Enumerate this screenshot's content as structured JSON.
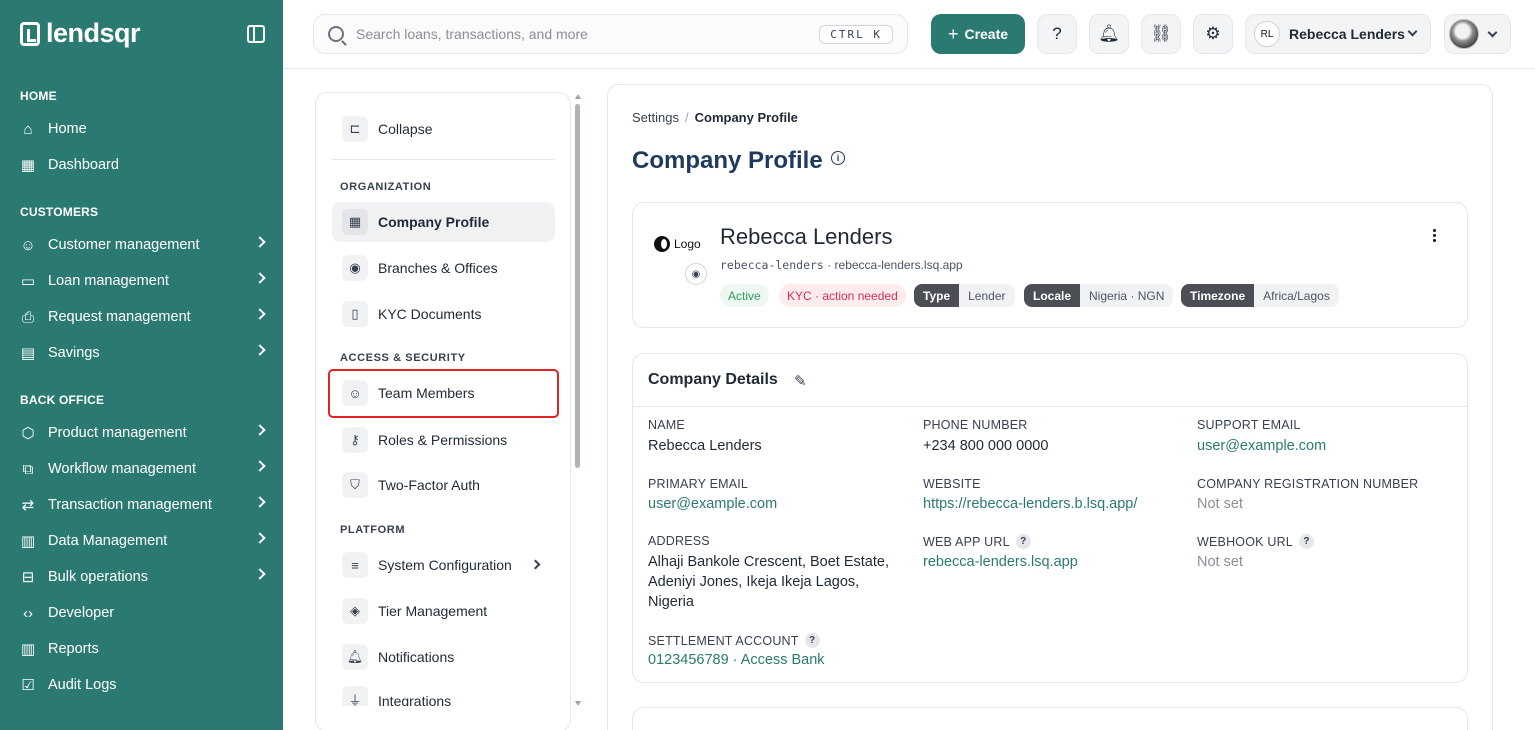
{
  "brand": {
    "name": "lendsqr"
  },
  "sidebar": {
    "sections": [
      {
        "label": "HOME"
      },
      {
        "label": "CUSTOMERS"
      },
      {
        "label": "BACK OFFICE"
      }
    ],
    "items": [
      {
        "label": "Home",
        "icon": "home-icon"
      },
      {
        "label": "Dashboard",
        "icon": "dashboard-icon"
      },
      {
        "label": "Customer management",
        "icon": "users-icon"
      },
      {
        "label": "Loan management",
        "icon": "loan-icon"
      },
      {
        "label": "Request management",
        "icon": "inbox-icon"
      },
      {
        "label": "Savings",
        "icon": "savings-icon"
      },
      {
        "label": "Product management",
        "icon": "box-icon"
      },
      {
        "label": "Workflow management",
        "icon": "workflow-icon"
      },
      {
        "label": "Transaction management",
        "icon": "transfer-icon"
      },
      {
        "label": "Data Management",
        "icon": "chart-icon"
      },
      {
        "label": "Bulk operations",
        "icon": "tray-icon"
      },
      {
        "label": "Developer",
        "icon": "code-icon"
      },
      {
        "label": "Reports",
        "icon": "reports-icon"
      },
      {
        "label": "Audit Logs",
        "icon": "clipboard-icon"
      }
    ]
  },
  "topbar": {
    "search_placeholder": "Search loans, transactions, and more",
    "shortcut": "CTRL K",
    "create_label": "Create",
    "org_initials": "RL",
    "org_name": "Rebecca Lenders"
  },
  "settings_nav": {
    "collapse_label": "Collapse",
    "sections": {
      "organization": "ORGANIZATION",
      "access": "ACCESS & SECURITY",
      "platform": "PLATFORM"
    },
    "items": [
      {
        "label": "Company Profile",
        "icon": "building-icon"
      },
      {
        "label": "Branches & Offices",
        "icon": "location-icon"
      },
      {
        "label": "KYC Documents",
        "icon": "document-icon"
      },
      {
        "label": "Team Members",
        "icon": "team-icon"
      },
      {
        "label": "Roles & Permissions",
        "icon": "key-icon"
      },
      {
        "label": "Two-Factor Auth",
        "icon": "shield-icon"
      },
      {
        "label": "System Configuration",
        "icon": "sliders-icon"
      },
      {
        "label": "Tier Management",
        "icon": "layers-icon"
      },
      {
        "label": "Notifications",
        "icon": "bell-icon"
      },
      {
        "label": "Integrations",
        "icon": "plug-icon"
      }
    ]
  },
  "breadcrumb": {
    "parent": "Settings",
    "separator": "/",
    "current": "Company Profile"
  },
  "page": {
    "title": "Company Profile"
  },
  "profile": {
    "logo_text": "Logo",
    "name": "Rebecca Lenders",
    "slug": "rebecca-lenders",
    "domain": "· rebecca-lenders.lsq.app",
    "status": "Active",
    "kyc": "KYC · action needed",
    "tags": [
      {
        "key": "Type",
        "value": "Lender"
      },
      {
        "key": "Locale",
        "value": "Nigeria · NGN"
      },
      {
        "key": "Timezone",
        "value": "Africa/Lagos"
      }
    ]
  },
  "details": {
    "title": "Company Details",
    "fields": {
      "name": {
        "label": "NAME",
        "value": "Rebecca Lenders"
      },
      "phone": {
        "label": "PHONE NUMBER",
        "value": "+234 800 000 0000"
      },
      "support_email": {
        "label": "SUPPORT EMAIL",
        "value": "user@example.com"
      },
      "primary_email": {
        "label": "PRIMARY EMAIL",
        "value": "user@example.com"
      },
      "website": {
        "label": "WEBSITE",
        "value": "https://rebecca-lenders.b.lsq.app/"
      },
      "reg_number": {
        "label": "COMPANY REGISTRATION NUMBER",
        "value": "Not set"
      },
      "address": {
        "label": "ADDRESS",
        "lines": [
          "Alhaji Bankole Crescent, Boet Estate,",
          "Adeniyi Jones, Ikeja Ikeja Lagos,",
          "Nigeria"
        ]
      },
      "web_app_url": {
        "label": "WEB APP URL",
        "value": "rebecca-lenders.lsq.app"
      },
      "webhook_url": {
        "label": "WEBHOOK URL",
        "value": "Not set"
      },
      "settlement": {
        "label": "SETTLEMENT ACCOUNT",
        "value": "0123456789 · Access Bank"
      }
    }
  },
  "colors": {
    "brand": "#2b7a72",
    "title": "#1e3a5f",
    "highlight": "#e02424"
  }
}
